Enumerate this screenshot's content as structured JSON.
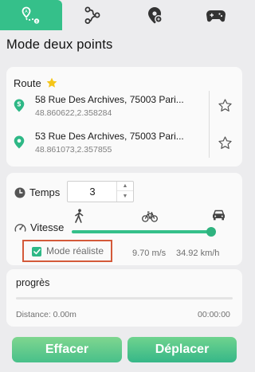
{
  "tabs": [
    {
      "icon": "route-pin-icon",
      "active": true
    },
    {
      "icon": "multi-stop-route-icon",
      "active": false
    },
    {
      "icon": "joystick-pin-icon",
      "active": false
    },
    {
      "icon": "gamepad-icon",
      "active": false
    }
  ],
  "title": "Mode deux points",
  "route": {
    "label": "Route",
    "label_icon": "star-filled-icon",
    "stops": [
      {
        "icon": "start-pin-icon",
        "address": "58 Rue Des Archives, 75003 Pari...",
        "coords": "48.860622,2.358284"
      },
      {
        "icon": "end-pin-icon",
        "address": "53 Rue Des Archives, 75003 Pari...",
        "coords": "48.861073,2.357855"
      }
    ]
  },
  "temps": {
    "label": "Temps",
    "icon": "clock-icon",
    "value": "3"
  },
  "vitesse": {
    "label": "Vitesse",
    "icon": "speedometer-icon",
    "modes": [
      "walk-icon",
      "bike-icon",
      "car-icon"
    ],
    "slider_fraction": 0.97,
    "realiste_label": "Mode réaliste",
    "realiste_checked": true,
    "speed_ms": "9.70 m/s",
    "speed_kmh": "34.92 km/h"
  },
  "progress": {
    "title": "progrès",
    "distance": "Distance: 0.00m",
    "time": "00:00:00",
    "fraction": 0
  },
  "buttons": {
    "clear": "Effacer",
    "move": "Déplacer"
  },
  "colors": {
    "accent": "#35c08a",
    "highlight_border": "#d45a3a",
    "star": "#f5c518"
  }
}
